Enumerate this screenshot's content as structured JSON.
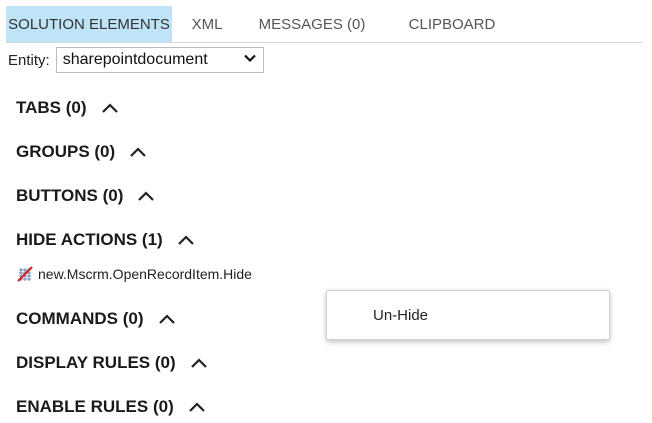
{
  "tabs": [
    {
      "label": "SOLUTION ELEMENTS",
      "active": true
    },
    {
      "label": "XML",
      "active": false
    },
    {
      "label": "MESSAGES (0)",
      "active": false
    },
    {
      "label": "CLIPBOARD",
      "active": false
    }
  ],
  "entity": {
    "label": "Entity:",
    "value": "sharepointdocument"
  },
  "sections": {
    "tabs": "TABS (0)",
    "groups": "GROUPS (0)",
    "buttons": "BUTTONS (0)",
    "hide_actions": "HIDE ACTIONS (1)",
    "commands": "COMMANDS (0)",
    "display_rules": "DISPLAY RULES (0)",
    "enable_rules": "ENABLE RULES (0)"
  },
  "hide_actions_items": [
    {
      "label": "new.Mscrm.OpenRecordItem.Hide",
      "icon": "hidden-element-icon"
    }
  ],
  "context_menu": {
    "items": [
      {
        "label": "Un-Hide"
      }
    ]
  },
  "colors": {
    "active_tab_bg": "#bfe3f7",
    "hide_icon_red": "#d62020",
    "hide_icon_blue": "#6a86b0"
  }
}
